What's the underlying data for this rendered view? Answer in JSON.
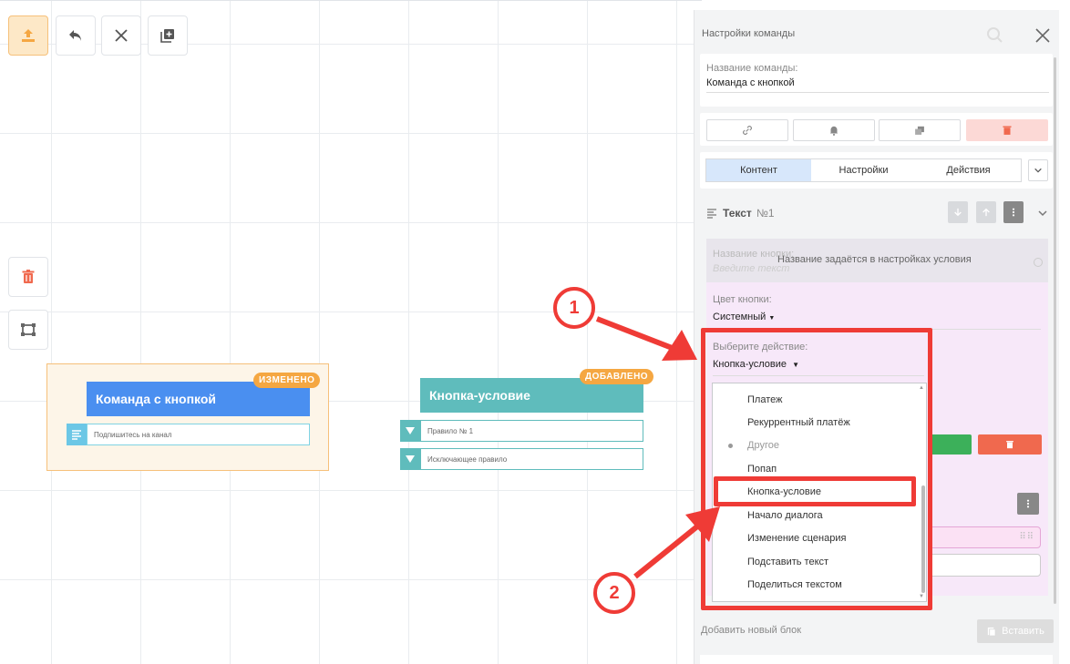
{
  "toolbar": {
    "upload_icon": "upload-icon",
    "undo_icon": "undo-icon",
    "close_icon": "close-icon",
    "add_icon": "add-square-icon"
  },
  "side_tools": {
    "delete_icon": "trash-icon",
    "frame_icon": "frame-select-icon"
  },
  "nodes": {
    "node1": {
      "title": "Команда с кнопкой",
      "badge": "ИЗМЕНЕНО",
      "row_text": "Подпишитесь на канал",
      "color": "#4a8ff0"
    },
    "node2": {
      "title": "Кнопка-условие",
      "badge": "ДОБАВЛЕНО",
      "rows": [
        "Правило № 1",
        "Исключающее правило"
      ],
      "color": "#5fbcbc"
    }
  },
  "panel": {
    "title": "Настройки команды",
    "command_name_label": "Название команды:",
    "command_name_value": "Команда с кнопкой",
    "tabs": [
      "Контент",
      "Настройки",
      "Действия"
    ],
    "block_title": "Текст",
    "block_number": "№1",
    "button_name_label": "Название кнопки:",
    "button_name_placeholder": "Введите текст",
    "button_name_overlay": "Название задаётся в настройках условия",
    "button_color_label": "Цвет кнопки:",
    "button_color_value": "Системный",
    "action_label": "Выберите действие:",
    "action_value": "Кнопка-условие",
    "add_block_label": "Добавить новый блок",
    "paste_label": "Вставить"
  },
  "dropdown": {
    "items": [
      {
        "label": "Платеж",
        "muted": false
      },
      {
        "label": "Рекуррентный платёж",
        "muted": false
      },
      {
        "label": "Другое",
        "muted": true
      },
      {
        "label": "Попап",
        "muted": false
      },
      {
        "label": "Кнопка-условие",
        "muted": false
      },
      {
        "label": "Начало диалога",
        "muted": false
      },
      {
        "label": "Изменение сценария",
        "muted": false
      },
      {
        "label": "Подставить текст",
        "muted": false
      },
      {
        "label": "Поделиться текстом",
        "muted": false
      }
    ]
  },
  "annotations": {
    "callout1": "1",
    "callout2": "2",
    "color": "#ef3b36"
  }
}
